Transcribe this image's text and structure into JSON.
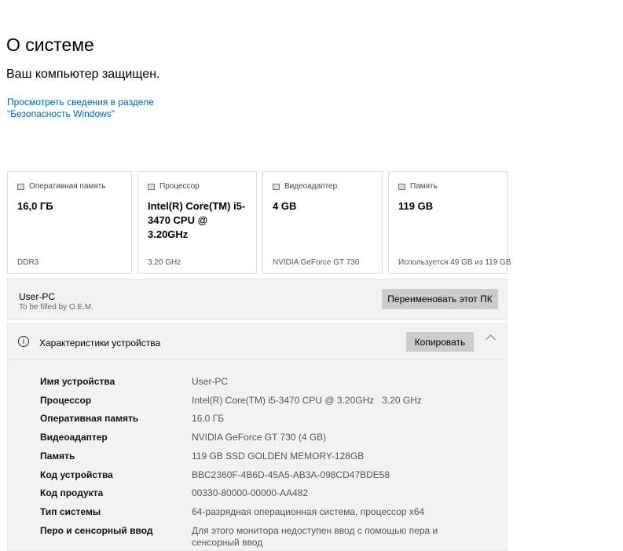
{
  "title": "О системе",
  "status": "Ваш компьютер защищен.",
  "security_link": "Просмотреть сведения в разделе \"Безопасность Windows\"",
  "cards": [
    {
      "icon": "ram-icon",
      "label": "Оперативная память",
      "value": "16,0 ГБ",
      "sub": "DDR3"
    },
    {
      "icon": "processor-icon",
      "label": "Процессор",
      "value": "Intel(R) Core(TM) i5-3470 CPU @ 3.20GHz",
      "sub": "3.20 GHz"
    },
    {
      "icon": "gpu-icon",
      "label": "Видеоадаптер",
      "value": "4 GB",
      "sub": "NVIDIA GeForce GT 730"
    },
    {
      "icon": "storage-icon",
      "label": "Память",
      "value": "119 GB",
      "sub": "Используется 49 GB из 119 GB"
    }
  ],
  "pc": {
    "name": "User-PC",
    "oem": "To be filled by O.E.M.",
    "rename": "Переименовать этот ПК"
  },
  "specs": {
    "title": "Характеристики устройства",
    "copy": "Копировать",
    "rows": [
      {
        "k": "Имя устройства",
        "v": "User-PC"
      },
      {
        "k": "Процессор",
        "v": "Intel(R) Core(TM) i5-3470 CPU @ 3.20GHz   3.20 GHz"
      },
      {
        "k": "Оперативная память",
        "v": "16,0 ГБ"
      },
      {
        "k": "Видеоадаптер",
        "v": "NVIDIA GeForce GT 730 (4 GB)"
      },
      {
        "k": "Память",
        "v": "119 GB SSD GOLDEN MEMORY-128GB"
      },
      {
        "k": "Код устройства",
        "v": "BBC2360F-4B6D-45A5-AB3A-098CD47BDE58"
      },
      {
        "k": "Код продукта",
        "v": "00330-80000-00000-AA482"
      },
      {
        "k": "Тип системы",
        "v": "64-разрядная операционная система, процессор x64"
      },
      {
        "k": "Перо и сенсорный ввод",
        "v": "Для этого монитора недоступен ввод с помощью пера и сенсорный ввод"
      }
    ]
  }
}
